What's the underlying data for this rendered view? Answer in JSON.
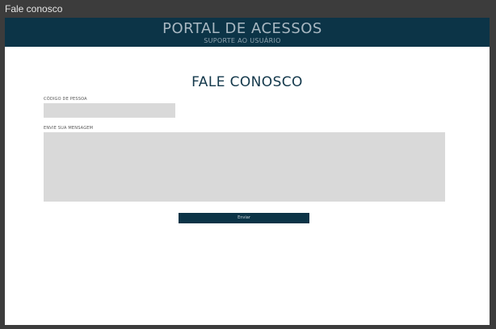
{
  "window": {
    "title": "Fale conosco"
  },
  "header": {
    "title": "PORTAL DE ACESSOS",
    "subtitle": "SUPORTE AO USUÁRIO"
  },
  "form": {
    "page_title": "FALE CONOSCO",
    "codigo_label": "CÓDIGO DE PESSOA",
    "codigo_value": "",
    "mensagem_label": "ENVIE SUA MENSAGEM",
    "mensagem_value": "",
    "submit_label": "Enviar"
  },
  "colors": {
    "header_bg": "#0c3447",
    "input_bg": "#d9d9d9",
    "button_bg": "#0c3447",
    "title_text": "#13384b"
  }
}
